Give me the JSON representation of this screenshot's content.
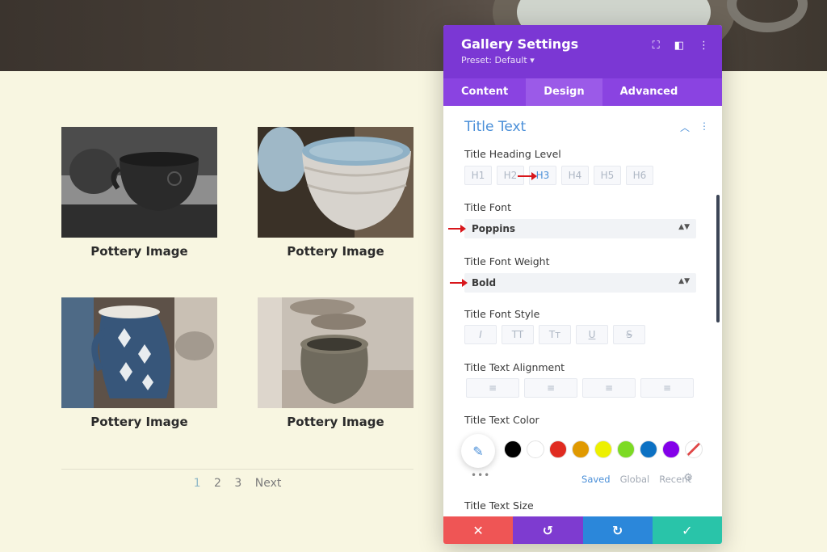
{
  "gallery": {
    "items": [
      {
        "caption": "Pottery Image"
      },
      {
        "caption": "Pottery Image"
      },
      {
        "caption": "Pottery Image"
      },
      {
        "caption": "Pottery Image"
      }
    ],
    "pagination": {
      "pages": [
        "1",
        "2",
        "3"
      ],
      "next": "Next",
      "active": "1"
    }
  },
  "modal": {
    "title": "Gallery Settings",
    "preset": "Preset: Default ▾",
    "header_icons": [
      "focus-icon",
      "split-view-icon",
      "more-vertical-icon"
    ],
    "tabs": [
      {
        "label": "Content",
        "active": false
      },
      {
        "label": "Design",
        "active": true
      },
      {
        "label": "Advanced",
        "active": false
      }
    ],
    "section_title": "Title Text",
    "heading_level": {
      "label": "Title Heading Level",
      "options": [
        "H1",
        "H2",
        "H3",
        "H4",
        "H5",
        "H6"
      ],
      "selected": "H3"
    },
    "font": {
      "label": "Title Font",
      "value": "Poppins"
    },
    "font_weight": {
      "label": "Title Font Weight",
      "value": "Bold"
    },
    "font_style": {
      "label": "Title Font Style",
      "options": [
        "I",
        "TT",
        "Tт",
        "U",
        "S"
      ]
    },
    "alignment": {
      "label": "Title Text Alignment"
    },
    "text_color": {
      "label": "Title Text Color",
      "swatches": [
        "#000000",
        "#ffffff",
        "#e02b20",
        "#e09900",
        "#edf000",
        "#7cda24",
        "#0c71c3",
        "#8300e9"
      ],
      "palette_tabs": [
        "Saved",
        "Global",
        "Recent"
      ],
      "active_palette": "Saved",
      "more": "•••"
    },
    "text_size": {
      "label": "Title Text Size"
    },
    "footer": [
      {
        "name": "cancel",
        "symbol": "✕",
        "color": "#ef5555"
      },
      {
        "name": "undo",
        "symbol": "↺",
        "color": "#7e3bd0"
      },
      {
        "name": "redo",
        "symbol": "↻",
        "color": "#2b87da"
      },
      {
        "name": "save",
        "symbol": "✓",
        "color": "#29c4a9"
      }
    ]
  }
}
